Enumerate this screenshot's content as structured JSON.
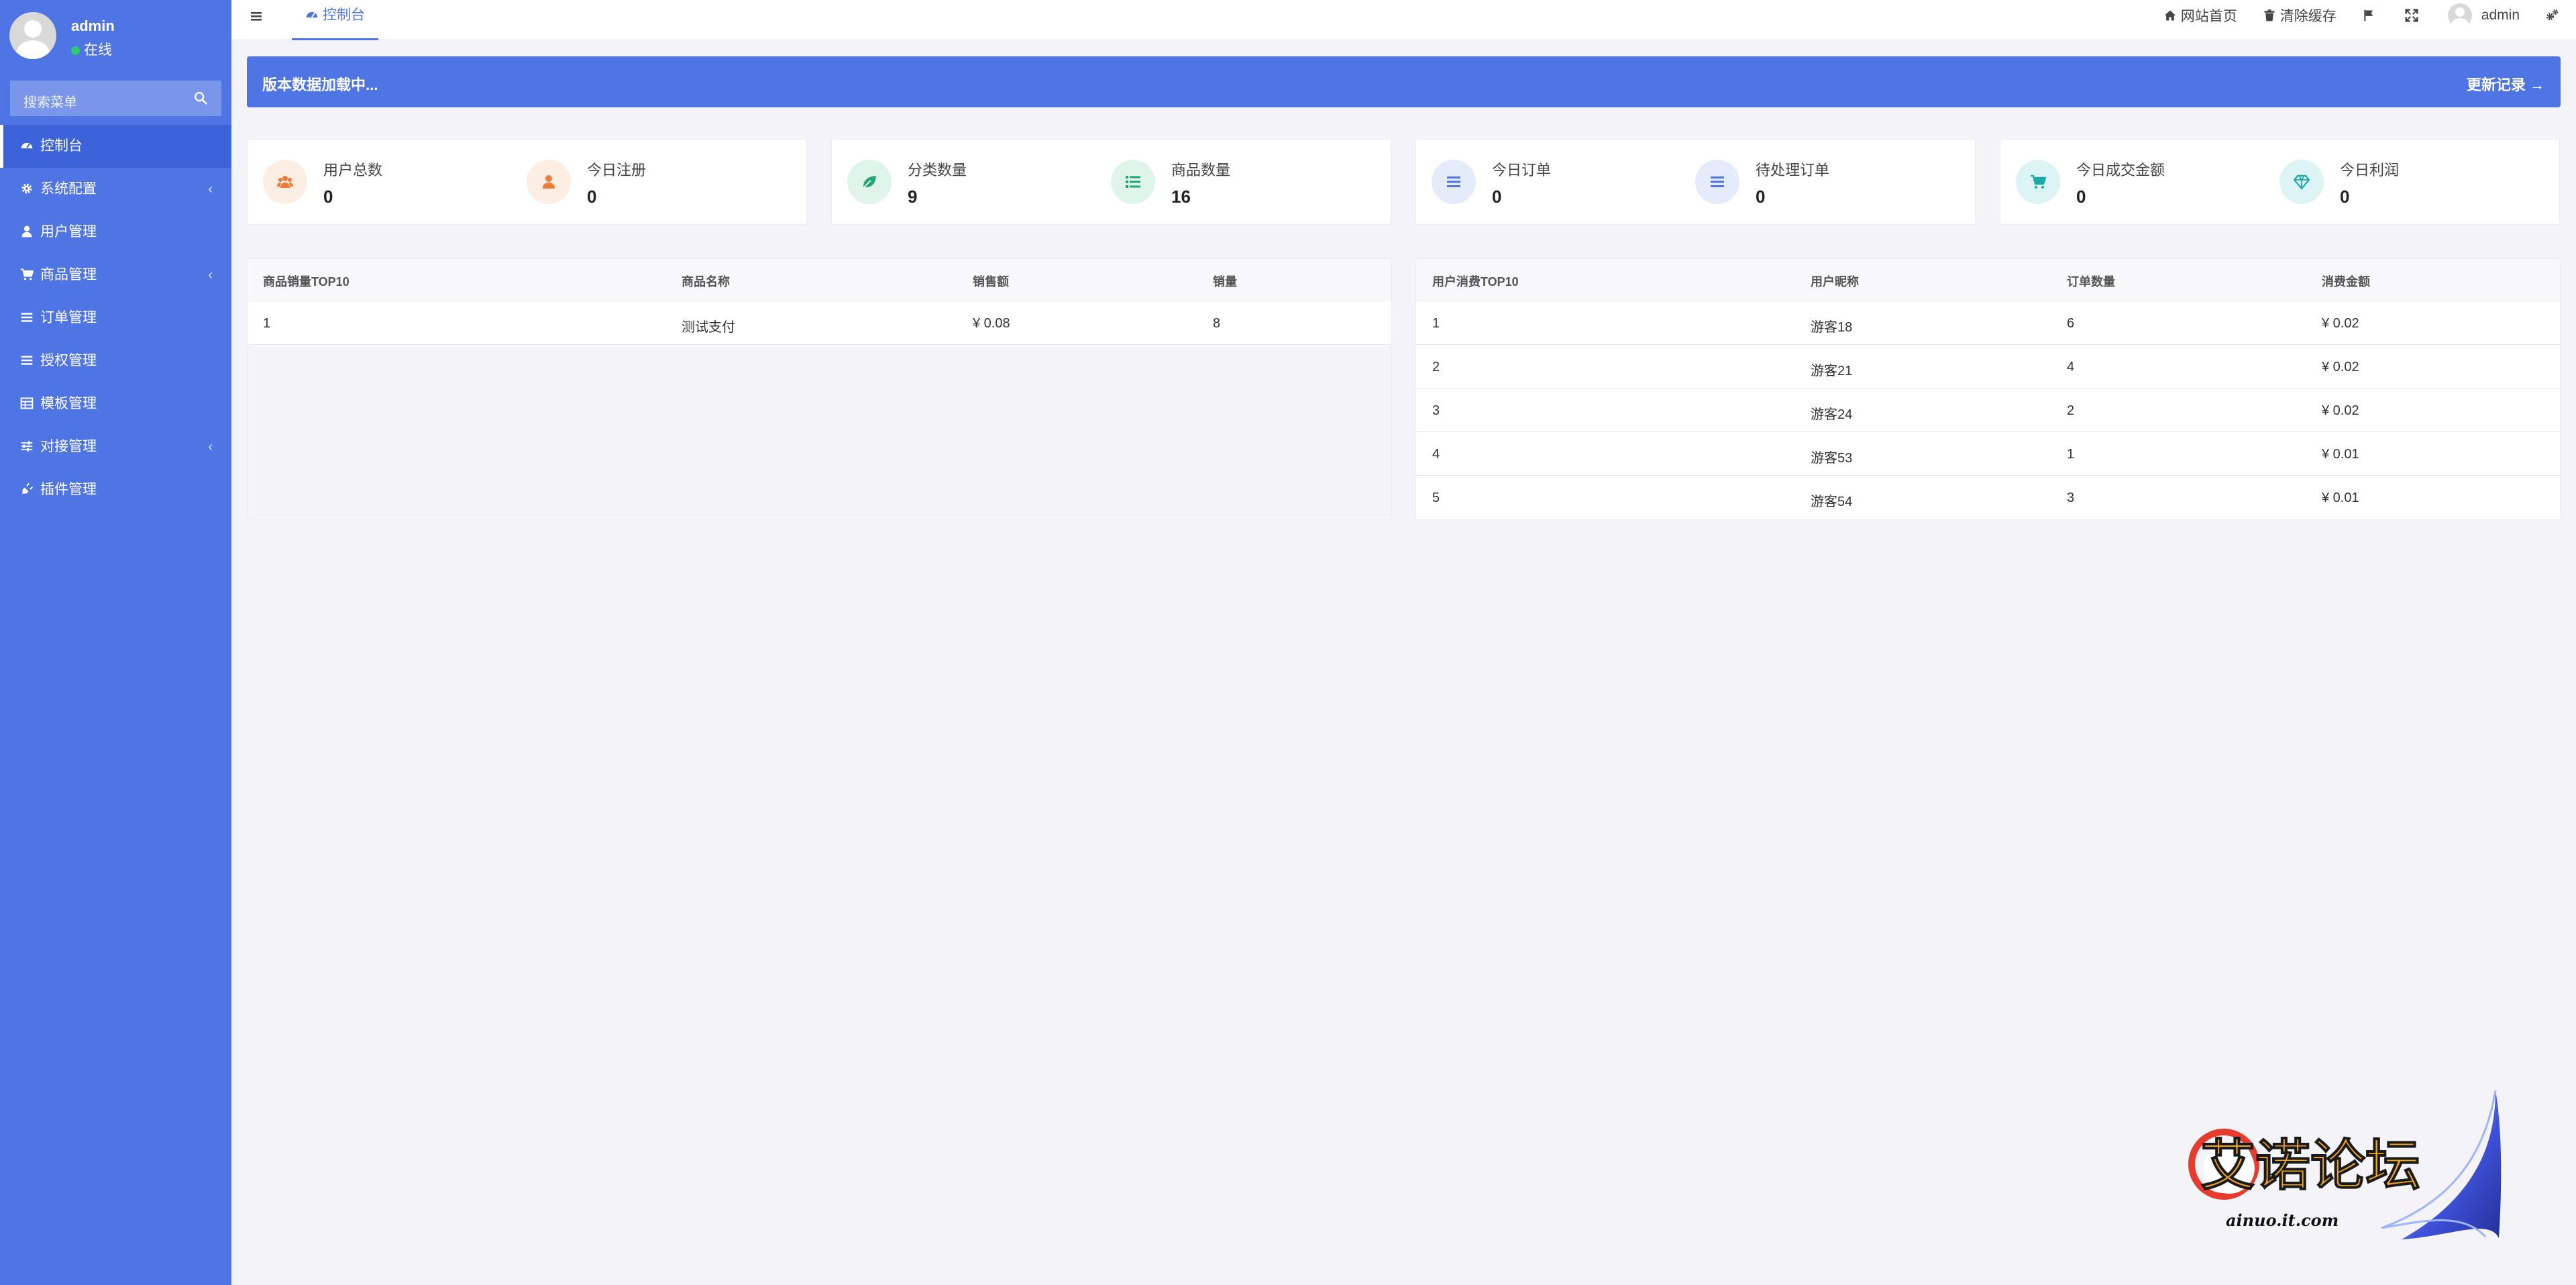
{
  "sidebar": {
    "user": {
      "name": "admin",
      "status": "在线"
    },
    "search_placeholder": "搜索菜单",
    "items": [
      {
        "label": "控制台",
        "icon": "dashboard-icon",
        "active": true,
        "has_children": false
      },
      {
        "label": "系统配置",
        "icon": "gear-icon",
        "active": false,
        "has_children": true
      },
      {
        "label": "用户管理",
        "icon": "user-icon",
        "active": false,
        "has_children": false
      },
      {
        "label": "商品管理",
        "icon": "cart-icon",
        "active": false,
        "has_children": true
      },
      {
        "label": "订单管理",
        "icon": "list-icon",
        "active": false,
        "has_children": false
      },
      {
        "label": "授权管理",
        "icon": "list-icon",
        "active": false,
        "has_children": false
      },
      {
        "label": "模板管理",
        "icon": "table-icon",
        "active": false,
        "has_children": false
      },
      {
        "label": "对接管理",
        "icon": "sliders-icon",
        "active": false,
        "has_children": true
      },
      {
        "label": "插件管理",
        "icon": "plug-icon",
        "active": false,
        "has_children": false
      }
    ]
  },
  "topbar": {
    "tab": "控制台",
    "links": {
      "home": "网站首页",
      "clear_cache": "清除缓存",
      "user": "admin"
    }
  },
  "notice": {
    "text": "版本数据加载中...",
    "link": "更新记录 →"
  },
  "stats": [
    {
      "label": "用户总数",
      "value": "0",
      "icon": "users-icon",
      "bg": "#fdeee3",
      "fg": "#f07a3a"
    },
    {
      "label": "今日注册",
      "value": "0",
      "icon": "user-icon",
      "bg": "#fdeee3",
      "fg": "#f07a3a"
    },
    {
      "label": "分类数量",
      "value": "9",
      "icon": "leaf-icon",
      "bg": "#dff5ec",
      "fg": "#21a56f"
    },
    {
      "label": "商品数量",
      "value": "16",
      "icon": "list-icon",
      "bg": "#dff5ec",
      "fg": "#21a56f"
    },
    {
      "label": "今日订单",
      "value": "0",
      "icon": "list-icon",
      "bg": "#e4ebfb",
      "fg": "#4f74e3"
    },
    {
      "label": "待处理订单",
      "value": "0",
      "icon": "list-icon",
      "bg": "#e4ebfb",
      "fg": "#4f74e3"
    },
    {
      "label": "今日成交金额",
      "value": "0",
      "icon": "cart-icon",
      "bg": "#ddf4f4",
      "fg": "#1fa8a8"
    },
    {
      "label": "今日利润",
      "value": "0",
      "icon": "diamond-icon",
      "bg": "#ddf4f4",
      "fg": "#1fa8a8"
    }
  ],
  "goods_table": {
    "headers": [
      "商品销量TOP10",
      "商品名称",
      "销售额",
      "销量"
    ],
    "rows": [
      [
        "1",
        "测试支付",
        "¥ 0.08",
        "8"
      ]
    ]
  },
  "users_table": {
    "headers": [
      "用户消费TOP10",
      "用户昵称",
      "订单数量",
      "消费金额"
    ],
    "rows": [
      [
        "1",
        "游客18",
        "6",
        "¥ 0.02"
      ],
      [
        "2",
        "游客21",
        "4",
        "¥ 0.02"
      ],
      [
        "3",
        "游客24",
        "2",
        "¥ 0.02"
      ],
      [
        "4",
        "游客53",
        "1",
        "¥ 0.01"
      ],
      [
        "5",
        "游客54",
        "3",
        "¥ 0.01"
      ]
    ]
  },
  "watermark": {
    "title": "艾诺论坛",
    "domain": "ainuo.it.com"
  }
}
